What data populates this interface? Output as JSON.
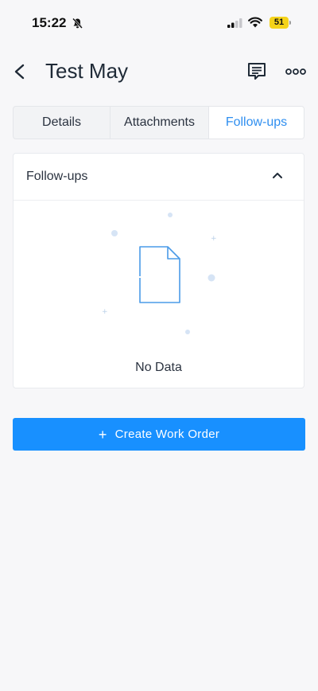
{
  "status_bar": {
    "time": "15:22",
    "battery_level": "51",
    "icons": [
      "bell-slash-icon",
      "signal-icon",
      "wifi-icon",
      "battery-icon"
    ]
  },
  "header": {
    "title": "Test May",
    "icons": [
      "chevron-left-icon",
      "message-icon",
      "more-icon"
    ]
  },
  "tabs": [
    {
      "label": "Details",
      "active": false
    },
    {
      "label": "Attachments",
      "active": false
    },
    {
      "label": "Follow-ups",
      "active": true
    }
  ],
  "followups_section": {
    "title": "Follow-ups",
    "empty_text": "No Data",
    "icons": [
      "chevron-up-icon",
      "document-icon"
    ]
  },
  "create_button": {
    "label": "Create Work Order",
    "icon": "plus-icon"
  },
  "colors": {
    "accent": "#1890ff",
    "active_tab_text": "#2f8ff0",
    "battery": "#f5d31a",
    "background": "#f7f7f9"
  }
}
